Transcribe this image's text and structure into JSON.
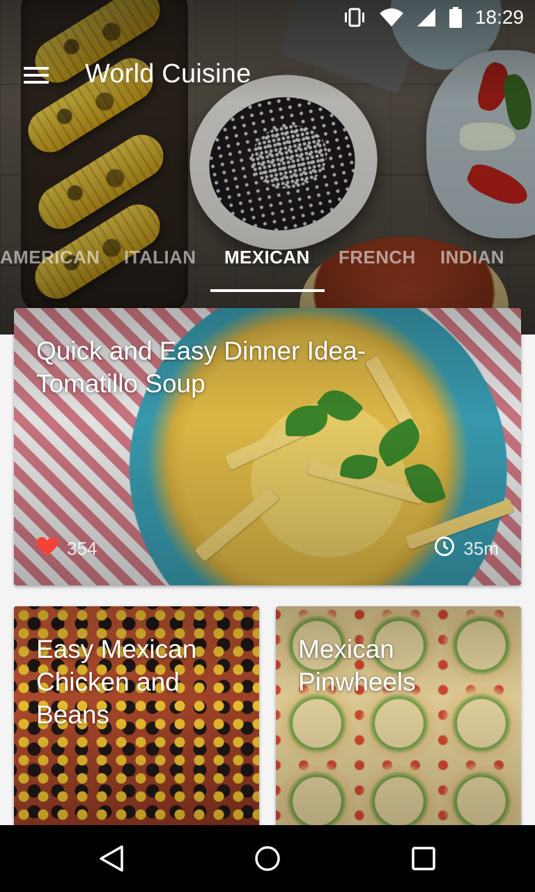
{
  "status_bar": {
    "time": "18:29",
    "icons": [
      "vibrate-icon",
      "wifi-icon",
      "signal-icon",
      "battery-icon"
    ]
  },
  "toolbar": {
    "title": "World Cuisine",
    "menu_icon": "menu-icon"
  },
  "tabs": {
    "items": [
      "AMERICAN",
      "ITALIAN",
      "MEXICAN",
      "FRENCH",
      "INDIAN"
    ],
    "active": "MEXICAN"
  },
  "featured": {
    "title": "Quick and Easy Dinner Idea- Tomatillo Soup",
    "likes": "354",
    "duration": "35m",
    "like_icon": "heart-icon",
    "time_icon": "clock-icon"
  },
  "recipes": [
    {
      "title": "Easy Mexican Chicken and Beans"
    },
    {
      "title": "Mexican Pinwheels"
    }
  ],
  "nav": {
    "back_icon": "back-icon",
    "home_icon": "home-icon",
    "recents_icon": "recents-icon"
  },
  "colors": {
    "heart": "#f44336",
    "nav_background": "#000000",
    "indicator": "#ffffff"
  }
}
